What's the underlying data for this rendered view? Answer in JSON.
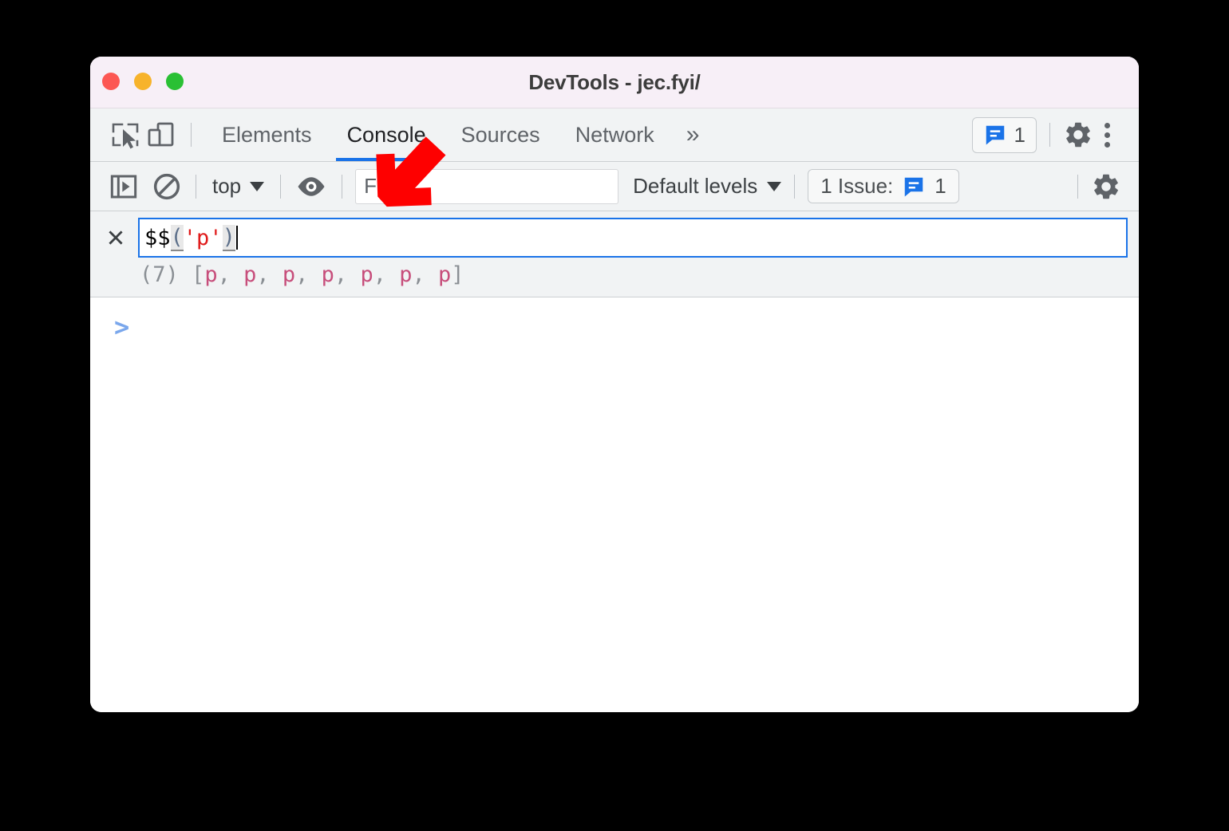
{
  "window": {
    "title": "DevTools - jec.fyi/",
    "traffic_lights": [
      "close-red",
      "minimize-yellow",
      "zoom-green"
    ]
  },
  "tabbar": {
    "inspect_icon": "inspect-element-icon",
    "device_icon": "device-toolbar-icon",
    "tabs": [
      {
        "label": "Elements",
        "active": false
      },
      {
        "label": "Console",
        "active": true
      },
      {
        "label": "Sources",
        "active": false
      },
      {
        "label": "Network",
        "active": false
      }
    ],
    "more_tabs_label": "»",
    "issue_badge": {
      "icon": "issue-bubble-icon",
      "count": "1"
    },
    "settings_icon": "gear-icon",
    "kebab_icon": "more-options-icon"
  },
  "console_toolbar": {
    "sidebar_toggle_icon": "console-sidebar-icon",
    "clear_icon": "clear-console-icon",
    "context_label": "top",
    "live_expression_icon": "eye-icon",
    "filter": {
      "placeholder": "Filter",
      "value": ""
    },
    "levels_label": "Default levels",
    "issues": {
      "label": "1 Issue:",
      "icon": "issue-bubble-icon",
      "count": "1"
    },
    "settings_icon": "gear-icon"
  },
  "console": {
    "live_expression": {
      "close_icon": "close-icon",
      "tokens": [
        {
          "text": "$$",
          "kind": "plain"
        },
        {
          "text": "(",
          "kind": "bracket"
        },
        {
          "text": "'p'",
          "kind": "string"
        },
        {
          "text": ")",
          "kind": "bracket"
        }
      ],
      "full_text": "$$('p')"
    },
    "result": {
      "count_label": "(7)",
      "open_bracket": "[",
      "items": [
        "p",
        "p",
        "p",
        "p",
        "p",
        "p",
        "p"
      ],
      "separator": ", ",
      "close_bracket": "]",
      "full_text": "(7) [p, p, p, p, p, p, p]"
    },
    "prompt_symbol": ">"
  },
  "annotation": {
    "arrow": "red-arrow-pointing-down-left",
    "color": "#fe0000"
  },
  "colors": {
    "accent_blue": "#1a73e8",
    "titlebar_bg": "#f7eff7",
    "toolbar_bg": "#f1f3f4",
    "string_red": "#e01b1b",
    "result_pink": "#c74e7b",
    "prompt_blue": "#7aa7ec",
    "annotation_red": "#fe0000"
  }
}
